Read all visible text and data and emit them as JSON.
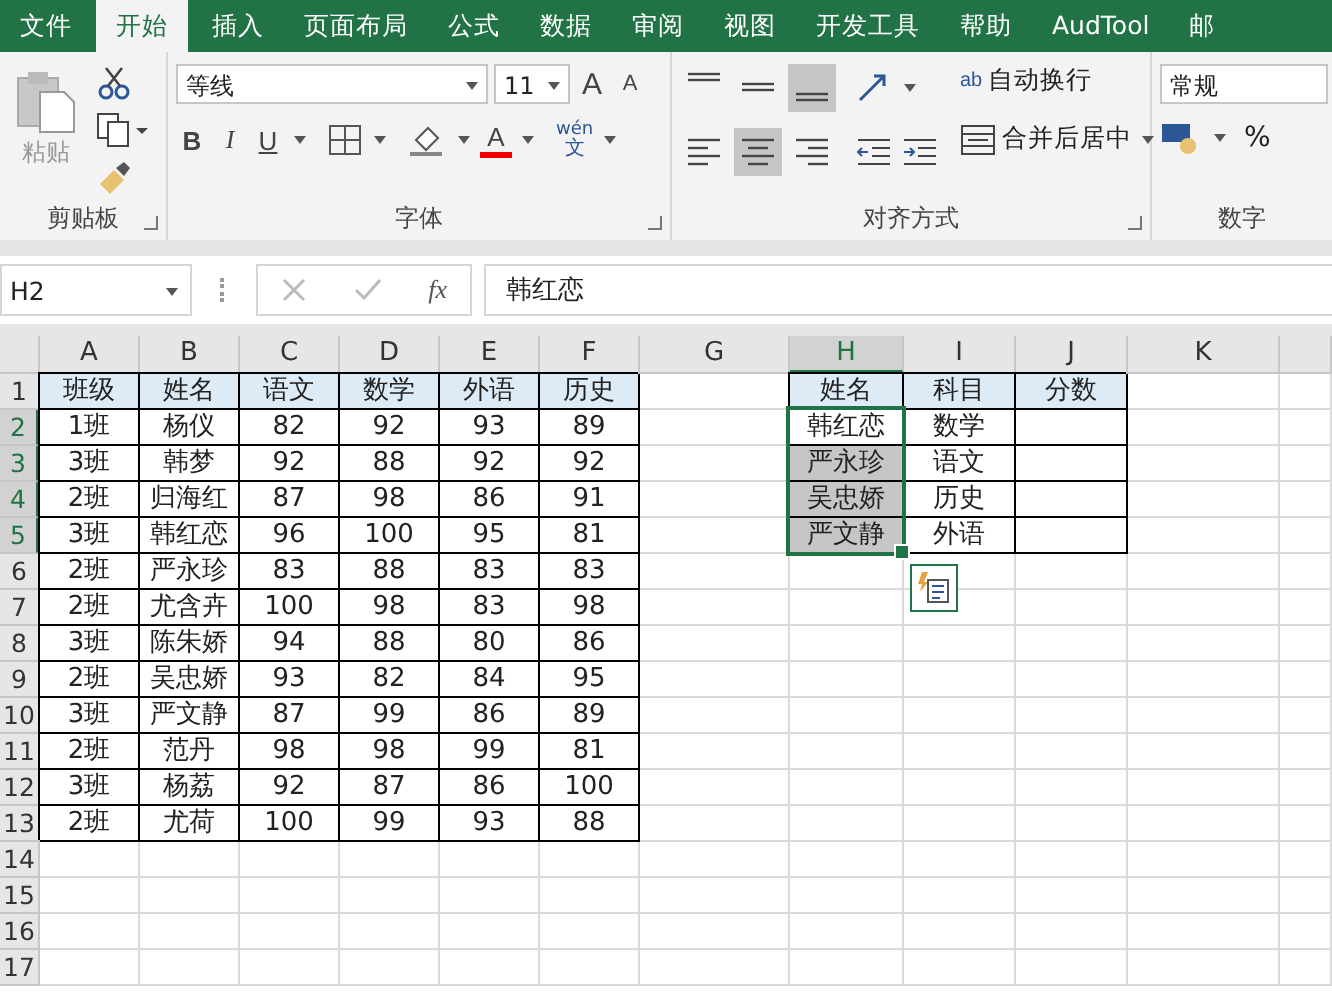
{
  "tabs": [
    {
      "label": "文件",
      "selected": false
    },
    {
      "label": "开始",
      "selected": true
    },
    {
      "label": "插入",
      "selected": false
    },
    {
      "label": "页面布局",
      "selected": false
    },
    {
      "label": "公式",
      "selected": false
    },
    {
      "label": "数据",
      "selected": false
    },
    {
      "label": "审阅",
      "selected": false
    },
    {
      "label": "视图",
      "selected": false
    },
    {
      "label": "开发工具",
      "selected": false
    },
    {
      "label": "帮助",
      "selected": false
    },
    {
      "label": "AudTool",
      "selected": false
    },
    {
      "label": "邮",
      "selected": false
    }
  ],
  "ribbon": {
    "clipboard": {
      "paste": "粘贴",
      "label": "剪贴板"
    },
    "font": {
      "name": "等线",
      "size": "11",
      "grow": "A",
      "shrink": "A",
      "bold": "B",
      "italic": "I",
      "underline": "U",
      "color_letter": "A",
      "phonetic_top": "wén",
      "phonetic_bottom": "文",
      "label": "字体"
    },
    "alignment": {
      "top_buttons": [
        {
          "kind": "top",
          "selected": false
        },
        {
          "kind": "middle",
          "selected": false
        },
        {
          "kind": "bottom",
          "selected": true
        }
      ],
      "bottom_buttons": [
        {
          "kind": "left",
          "selected": false
        },
        {
          "kind": "center",
          "selected": true
        },
        {
          "kind": "right",
          "selected": false
        }
      ],
      "wrap_icon": "ab",
      "wrap": "自动换行",
      "merge": "合并后居中",
      "label": "对齐方式"
    },
    "number": {
      "format": "常规",
      "percent": "%",
      "label": "数字"
    }
  },
  "formula_bar": {
    "name_box": "H2",
    "fx": "fx",
    "formula": "韩红恋"
  },
  "columns": [
    {
      "letter": "A",
      "selected": false
    },
    {
      "letter": "B",
      "selected": false
    },
    {
      "letter": "C",
      "selected": false
    },
    {
      "letter": "D",
      "selected": false
    },
    {
      "letter": "E",
      "selected": false
    },
    {
      "letter": "F",
      "selected": false
    },
    {
      "letter": "G",
      "selected": false
    },
    {
      "letter": "H",
      "selected": true
    },
    {
      "letter": "I",
      "selected": false
    },
    {
      "letter": "J",
      "selected": false
    },
    {
      "letter": "K",
      "selected": false
    }
  ],
  "rows": [
    {
      "num": "1",
      "selected": false,
      "cells": [
        {
          "kind": "header",
          "text": "班级"
        },
        {
          "kind": "header",
          "text": "姓名"
        },
        {
          "kind": "header",
          "text": "语文"
        },
        {
          "kind": "header",
          "text": "数学"
        },
        {
          "kind": "header",
          "text": "外语"
        },
        {
          "kind": "header",
          "text": "历史"
        },
        {
          "kind": "empty"
        },
        {
          "kind": "header",
          "text": "姓名"
        },
        {
          "kind": "header",
          "text": "科目"
        },
        {
          "kind": "header",
          "text": "分数"
        }
      ]
    },
    {
      "num": "2",
      "selected": true,
      "cells": [
        {
          "kind": "data",
          "text": "1班"
        },
        {
          "kind": "data",
          "text": "杨仪"
        },
        {
          "kind": "data",
          "text": "82"
        },
        {
          "kind": "data",
          "text": "92"
        },
        {
          "kind": "data",
          "text": "93"
        },
        {
          "kind": "data",
          "text": "89"
        },
        {
          "kind": "empty"
        },
        {
          "kind": "data",
          "text": "韩红恋"
        },
        {
          "kind": "data",
          "text": "数学"
        },
        {
          "kind": "data"
        }
      ]
    },
    {
      "num": "3",
      "selected": true,
      "cells": [
        {
          "kind": "data",
          "text": "3班"
        },
        {
          "kind": "data",
          "text": "韩梦"
        },
        {
          "kind": "data",
          "text": "92"
        },
        {
          "kind": "data",
          "text": "88"
        },
        {
          "kind": "data",
          "text": "92"
        },
        {
          "kind": "data",
          "text": "92"
        },
        {
          "kind": "empty"
        },
        {
          "kind": "data",
          "text": "严永珍"
        },
        {
          "kind": "data",
          "text": "语文"
        },
        {
          "kind": "data"
        }
      ]
    },
    {
      "num": "4",
      "selected": true,
      "cells": [
        {
          "kind": "data",
          "text": "2班"
        },
        {
          "kind": "data",
          "text": "归海红"
        },
        {
          "kind": "data",
          "text": "87"
        },
        {
          "kind": "data",
          "text": "98"
        },
        {
          "kind": "data",
          "text": "86"
        },
        {
          "kind": "data",
          "text": "91"
        },
        {
          "kind": "empty"
        },
        {
          "kind": "data",
          "text": "吴忠娇"
        },
        {
          "kind": "data",
          "text": "历史"
        },
        {
          "kind": "data"
        }
      ]
    },
    {
      "num": "5",
      "selected": true,
      "cells": [
        {
          "kind": "data",
          "text": "3班"
        },
        {
          "kind": "data",
          "text": "韩红恋"
        },
        {
          "kind": "data",
          "text": "96"
        },
        {
          "kind": "data",
          "text": "100"
        },
        {
          "kind": "data",
          "text": "95"
        },
        {
          "kind": "data",
          "text": "81"
        },
        {
          "kind": "empty"
        },
        {
          "kind": "data",
          "text": "严文静"
        },
        {
          "kind": "data",
          "text": "外语"
        },
        {
          "kind": "data"
        }
      ]
    },
    {
      "num": "6",
      "selected": false,
      "cells": [
        {
          "kind": "data",
          "text": "2班"
        },
        {
          "kind": "data",
          "text": "严永珍"
        },
        {
          "kind": "data",
          "text": "83"
        },
        {
          "kind": "data",
          "text": "88"
        },
        {
          "kind": "data",
          "text": "83"
        },
        {
          "kind": "data",
          "text": "83"
        }
      ]
    },
    {
      "num": "7",
      "selected": false,
      "cells": [
        {
          "kind": "data",
          "text": "2班"
        },
        {
          "kind": "data",
          "text": "尤含卉"
        },
        {
          "kind": "data",
          "text": "100"
        },
        {
          "kind": "data",
          "text": "98"
        },
        {
          "kind": "data",
          "text": "83"
        },
        {
          "kind": "data",
          "text": "98"
        }
      ]
    },
    {
      "num": "8",
      "selected": false,
      "cells": [
        {
          "kind": "data",
          "text": "3班"
        },
        {
          "kind": "data",
          "text": "陈朱娇"
        },
        {
          "kind": "data",
          "text": "94"
        },
        {
          "kind": "data",
          "text": "88"
        },
        {
          "kind": "data",
          "text": "80"
        },
        {
          "kind": "data",
          "text": "86"
        }
      ]
    },
    {
      "num": "9",
      "selected": false,
      "cells": [
        {
          "kind": "data",
          "text": "2班"
        },
        {
          "kind": "data",
          "text": "吴忠娇"
        },
        {
          "kind": "data",
          "text": "93"
        },
        {
          "kind": "data",
          "text": "82"
        },
        {
          "kind": "data",
          "text": "84"
        },
        {
          "kind": "data",
          "text": "95"
        }
      ]
    },
    {
      "num": "10",
      "selected": false,
      "cells": [
        {
          "kind": "data",
          "text": "3班"
        },
        {
          "kind": "data",
          "text": "严文静"
        },
        {
          "kind": "data",
          "text": "87"
        },
        {
          "kind": "data",
          "text": "99"
        },
        {
          "kind": "data",
          "text": "86"
        },
        {
          "kind": "data",
          "text": "89"
        }
      ]
    },
    {
      "num": "11",
      "selected": false,
      "cells": [
        {
          "kind": "data",
          "text": "2班"
        },
        {
          "kind": "data",
          "text": "范丹"
        },
        {
          "kind": "data",
          "text": "98"
        },
        {
          "kind": "data",
          "text": "98"
        },
        {
          "kind": "data",
          "text": "99"
        },
        {
          "kind": "data",
          "text": "81"
        }
      ]
    },
    {
      "num": "12",
      "selected": false,
      "cells": [
        {
          "kind": "data",
          "text": "3班"
        },
        {
          "kind": "data",
          "text": "杨荔"
        },
        {
          "kind": "data",
          "text": "92"
        },
        {
          "kind": "data",
          "text": "87"
        },
        {
          "kind": "data",
          "text": "86"
        },
        {
          "kind": "data",
          "text": "100"
        }
      ]
    },
    {
      "num": "13",
      "selected": false,
      "cells": [
        {
          "kind": "data",
          "text": "2班"
        },
        {
          "kind": "data",
          "text": "尤荷"
        },
        {
          "kind": "data",
          "text": "100"
        },
        {
          "kind": "data",
          "text": "99"
        },
        {
          "kind": "data",
          "text": "93"
        },
        {
          "kind": "data",
          "text": "88"
        }
      ]
    },
    {
      "num": "14",
      "selected": false,
      "cells": []
    },
    {
      "num": "15",
      "selected": false,
      "cells": []
    },
    {
      "num": "16",
      "selected": false,
      "cells": []
    },
    {
      "num": "17",
      "selected": false,
      "cells": []
    }
  ]
}
